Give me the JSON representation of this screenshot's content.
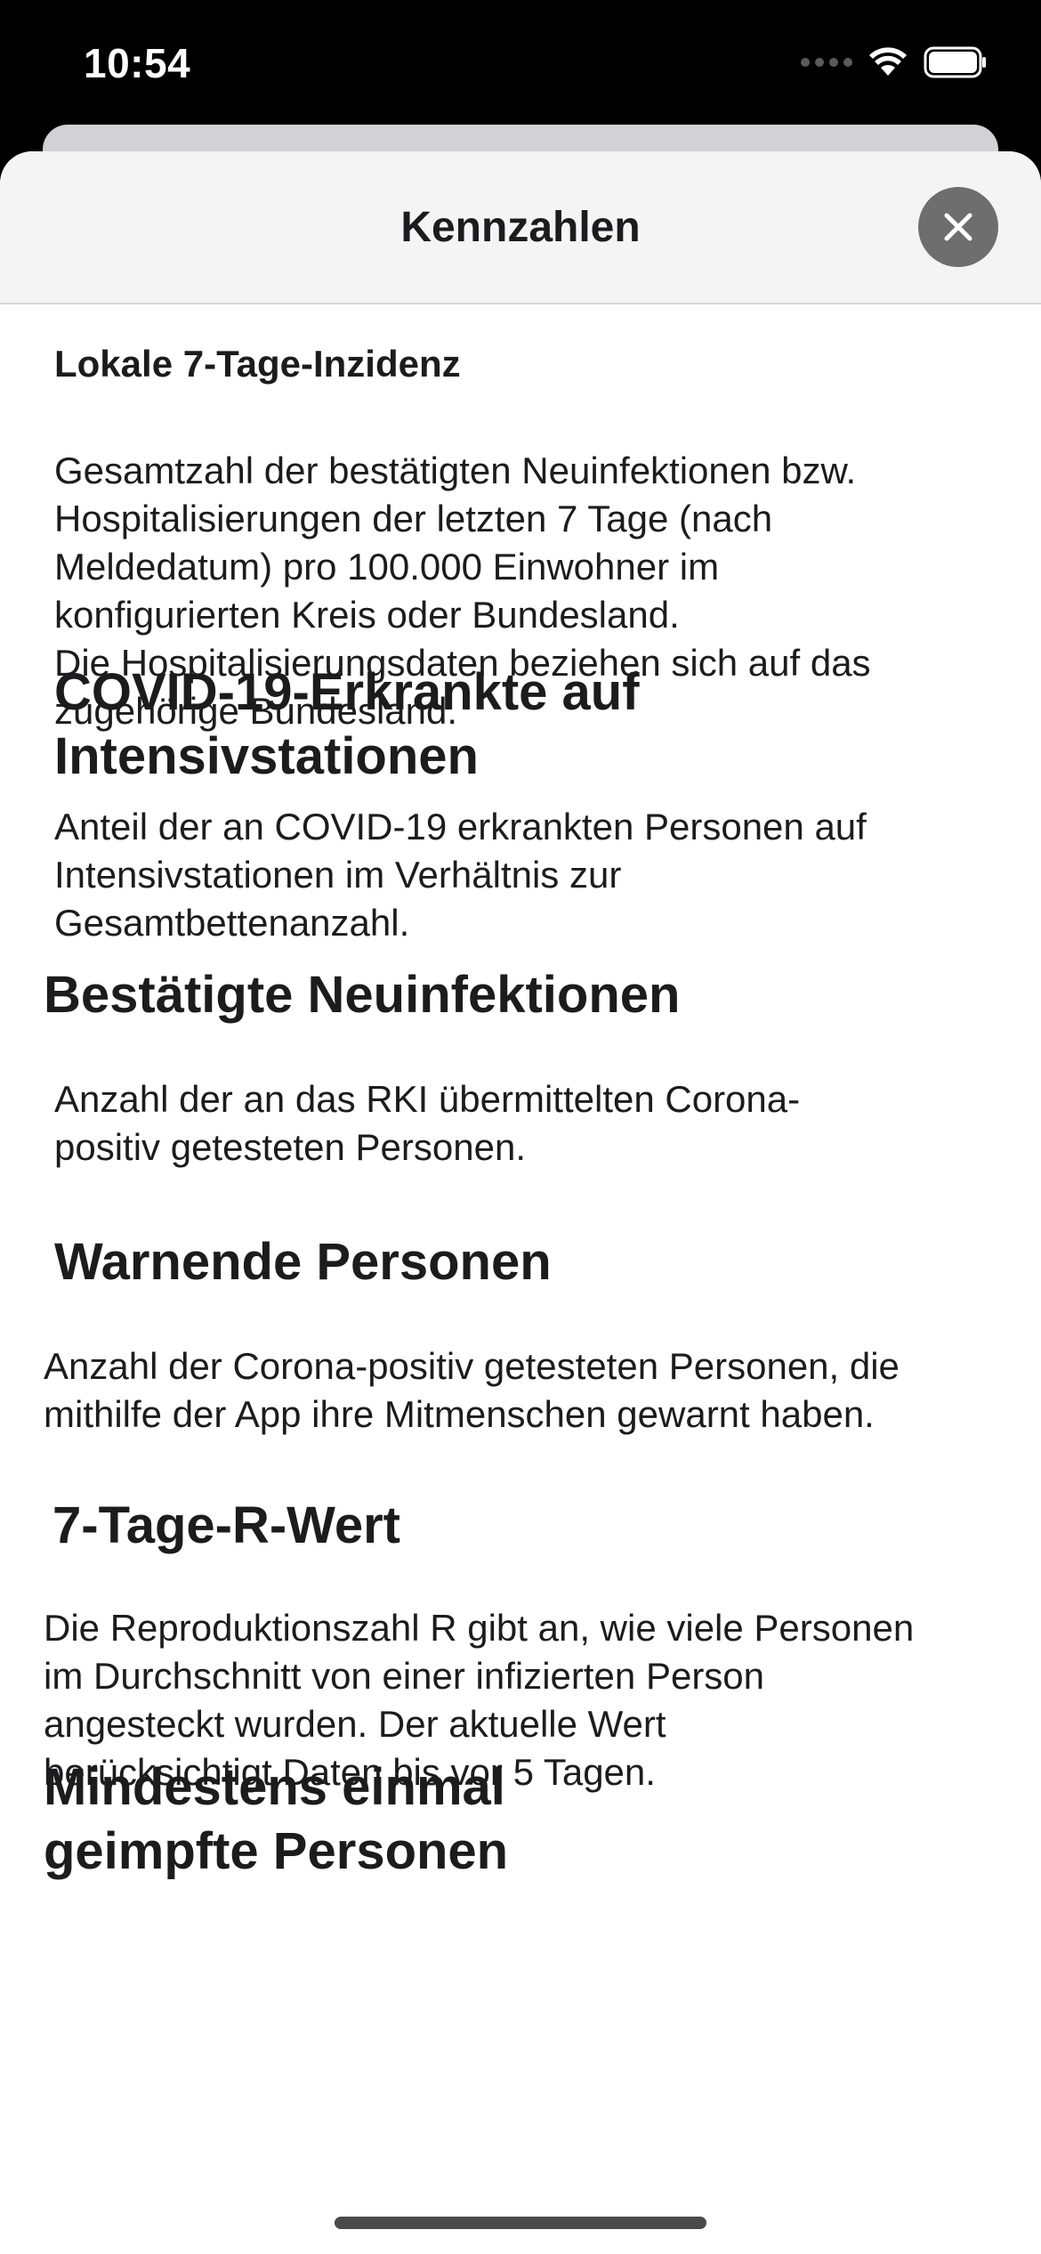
{
  "status_bar": {
    "time": "10:54"
  },
  "sheet": {
    "title": "Kennzahlen",
    "close_icon": "close-icon"
  },
  "sections": [
    {
      "heading": "Lokale 7-Tage-Inzidenz",
      "text": "Gesamtzahl der bestätigten Neuinfektionen bzw.\nHospitalisierungen der letzten 7 Tage (nach\nMeldedatum) pro 100.000 Einwohner im\nkonfigurierten Kreis oder Bundesland.\nDie Hospitalisierungsdaten beziehen sich auf das\nzugehörige Bundesland."
    },
    {
      "heading": "COVID-19-Erkrankte auf\nIntensivstationen",
      "text": "Anteil der an COVID-19 erkrankten Personen auf\nIntensivstationen im Verhältnis zur\nGesamtbettenanzahl."
    },
    {
      "heading": "Bestätigte Neuinfektionen",
      "text": "Anzahl der an das RKI übermittelten Corona-\npositiv getesteten Personen."
    },
    {
      "heading": "Warnende Personen",
      "text": "Anzahl der Corona-positiv getesteten Personen, die\nmithilfe der App ihre Mitmenschen gewarnt haben."
    },
    {
      "heading": "7-Tage-R-Wert",
      "text": "Die Reproduktionszahl R gibt an, wie viele Personen\nim Durchschnitt von einer infizierten Person\nangesteckt wurden. Der aktuelle Wert\nberücksichtigt Daten bis vor 5 Tagen."
    },
    {
      "heading": "Mindestens einmal\ngeimpfte Personen",
      "text": ""
    }
  ]
}
